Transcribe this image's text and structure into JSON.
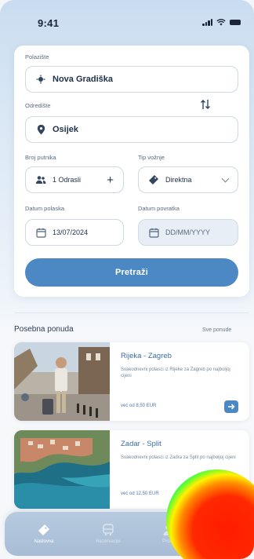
{
  "status_bar": {
    "time": "9:41"
  },
  "search": {
    "from_label": "Polazište",
    "from_value": "Nova Gradiška",
    "to_label": "Odredište",
    "to_value": "Osijek",
    "passengers_label": "Broj putnika",
    "passengers_value": "1 Odrasli",
    "trip_type_label": "Tip vožnje",
    "trip_type_value": "Direktna",
    "departure_label": "Datum polaska",
    "departure_value": "13/07/2024",
    "return_label": "Datum povratka",
    "return_placeholder": "DD/MM/YYYY",
    "button_label": "Pretraži"
  },
  "offers": {
    "title": "Posebna ponuda",
    "see_all": "Sve ponude",
    "items": [
      {
        "title": "Rijeka - Zagreb",
        "description": "Svakodnevni polasci iz Rijeke za Zagreb po najboljoj cijeni",
        "price": "već od 8,50 EUR"
      },
      {
        "title": "Zadar - Split",
        "description": "Svakodnevni polasci iz Zadra za Split po najboljoj cijeni",
        "price": "već od 12,50 EUR"
      }
    ]
  },
  "nav": {
    "items": [
      {
        "label": "Naslovna",
        "icon": "ticket-icon"
      },
      {
        "label": "Rezervacije",
        "icon": "bus-icon"
      },
      {
        "label": "Profil",
        "icon": "user-icon"
      }
    ]
  },
  "colors": {
    "accent": "#4c88c4",
    "offer_title": "#3b6fa3"
  }
}
